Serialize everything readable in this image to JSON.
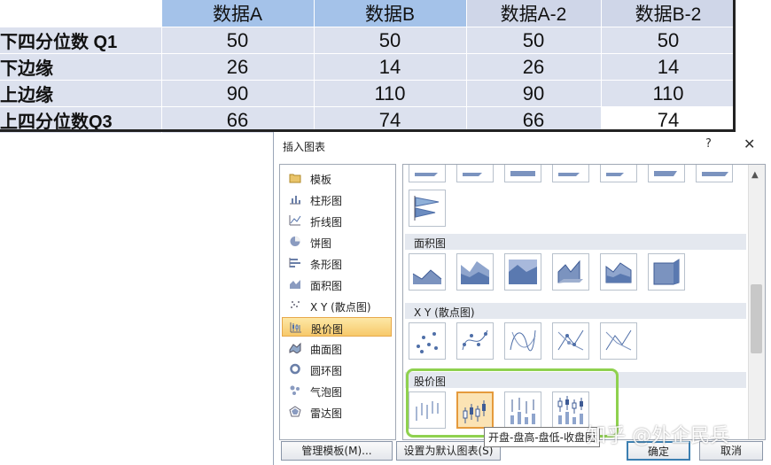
{
  "sheet": {
    "headers": [
      "",
      "数据A",
      "数据B",
      "数据A-2",
      "数据B-2"
    ],
    "rows": [
      {
        "label": "下四分位数 Q1",
        "values": [
          "50",
          "50",
          "50",
          "50"
        ]
      },
      {
        "label": "下边缘",
        "values": [
          "26",
          "14",
          "26",
          "14"
        ]
      },
      {
        "label": "上边缘",
        "values": [
          "90",
          "110",
          "90",
          "110"
        ]
      },
      {
        "label": "上四分位数Q3",
        "values": [
          "66",
          "74",
          "66",
          "74"
        ]
      }
    ]
  },
  "dialog": {
    "title": "插入图表",
    "help": "?",
    "close": "✕",
    "types": [
      {
        "label": "模板",
        "icon": "folder-icon"
      },
      {
        "label": "柱形图",
        "icon": "column-chart-icon"
      },
      {
        "label": "折线图",
        "icon": "line-chart-icon"
      },
      {
        "label": "饼图",
        "icon": "pie-chart-icon"
      },
      {
        "label": "条形图",
        "icon": "bar-chart-icon"
      },
      {
        "label": "面积图",
        "icon": "area-chart-icon"
      },
      {
        "label": "X Y (散点图)",
        "icon": "scatter-chart-icon"
      },
      {
        "label": "股价图",
        "icon": "stock-chart-icon"
      },
      {
        "label": "曲面图",
        "icon": "surface-chart-icon"
      },
      {
        "label": "圆环图",
        "icon": "doughnut-chart-icon"
      },
      {
        "label": "气泡图",
        "icon": "bubble-chart-icon"
      },
      {
        "label": "雷达图",
        "icon": "radar-chart-icon"
      }
    ],
    "selected_type": "股价图",
    "sections": {
      "area": "面积图",
      "scatter": "X Y (散点图)",
      "stock": "股价图"
    },
    "tooltip": "开盘-盘高-盘低-收盘图",
    "buttons": {
      "manage": "管理模板(M)...",
      "set_default": "设置为默认图表(S)",
      "ok": "确定",
      "cancel": "取消"
    }
  },
  "watermark": "知乎 @外企民兵",
  "colors": {
    "header_blue": "#a4c2e9",
    "cell_fill": "#dce1ee",
    "selection_orange": "#f7c96a",
    "highlight_green": "#8fd14f"
  }
}
